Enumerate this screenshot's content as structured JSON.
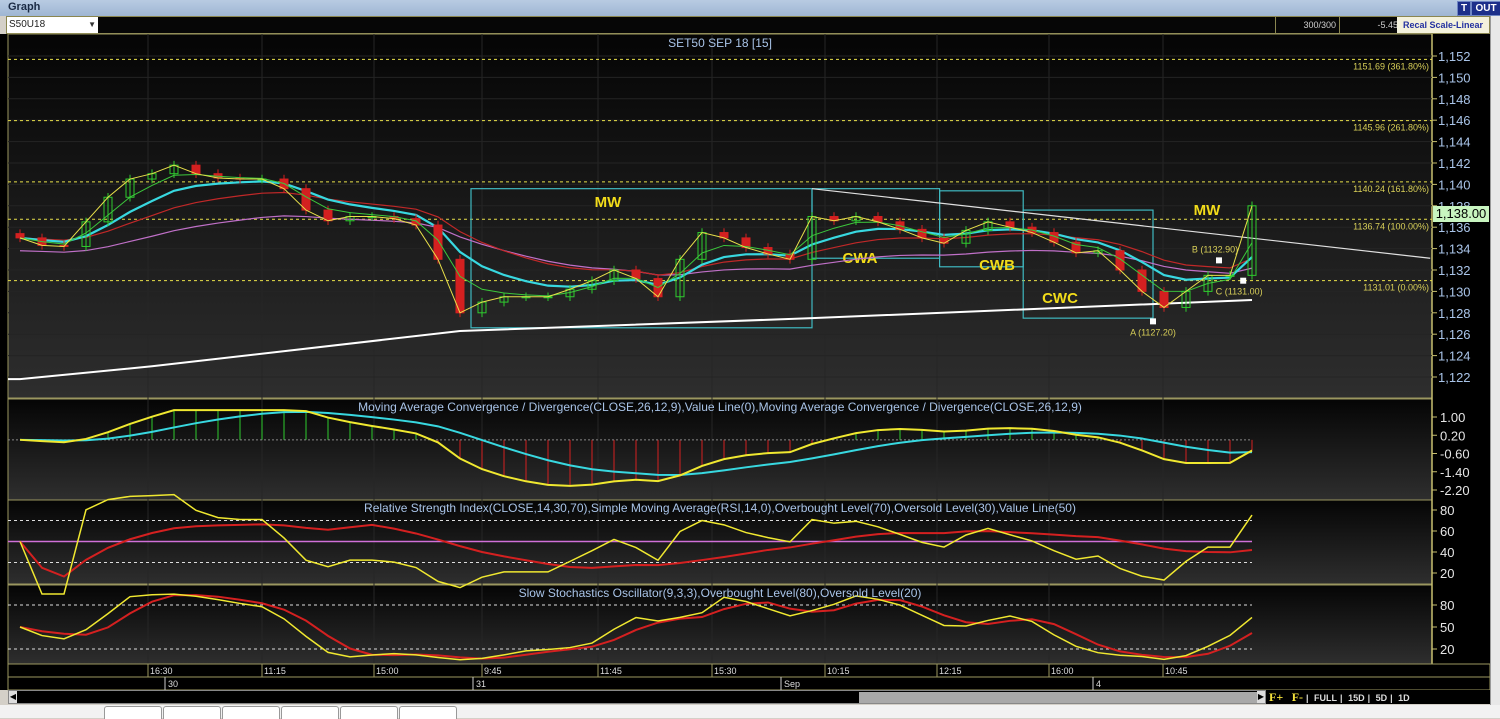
{
  "window": {
    "title": "Graph",
    "t_button": "T",
    "out_button": "OUT"
  },
  "toolbar": {
    "symbol": "S50U18",
    "bars": "300/300",
    "change": "-5.45",
    "recal_button": "Recal Scale-Linear"
  },
  "zoombar": {
    "f_plus": "F+",
    "f_minus": "F-",
    "full": "FULL",
    "d15": "15D",
    "d5": "5D",
    "d1": "1D"
  },
  "colors": {
    "background": "#000000",
    "bull": "#2ecc2e",
    "bear": "#d42020",
    "fib": "#e8e04a",
    "box": "#3fb8c0",
    "axis_text": "#a9c4e8",
    "last_price_bg": "#c8f5c0"
  },
  "chart_data": [
    {
      "type": "candlestick",
      "title": "SET50 SEP 18   [15]",
      "ylim": [
        1121,
        1153
      ],
      "yticks": [
        "1,152",
        "1,150",
        "1,148",
        "1,146",
        "1,144",
        "1,142",
        "1,140",
        "1,138",
        "1,136",
        "1,134",
        "1,132",
        "1,130",
        "1,128",
        "1,126",
        "1,124",
        "1,122"
      ],
      "last_price": "1,138.00",
      "close": [
        1135,
        1134.3,
        1134.2,
        1136.5,
        1138.8,
        1140.5,
        1141,
        1141.8,
        1141,
        1140.6,
        1140.5,
        1140.5,
        1139.6,
        1137.6,
        1136.6,
        1137,
        1137,
        1136.8,
        1136.2,
        1133,
        1128,
        1129,
        1129.5,
        1129.5,
        1129.5,
        1130.2,
        1131,
        1132,
        1131.2,
        1129.5,
        1133,
        1135.5,
        1135,
        1134.1,
        1133.5,
        1133,
        1137,
        1136.6,
        1137,
        1136.5,
        1135.8,
        1135,
        1134.5,
        1135.7,
        1136.5,
        1136,
        1135.5,
        1134.6,
        1133.6,
        1133.8,
        1132,
        1130,
        1128.5,
        1130,
        1131.5,
        1131.5,
        1138
      ],
      "long_ma": [
        {
          "bar": 0,
          "value": 1121.8
        },
        {
          "bar": 6,
          "value": 1123
        },
        {
          "bar": 20,
          "value": 1126.3
        },
        {
          "bar": 36,
          "value": 1127.5
        },
        {
          "bar": 56,
          "value": 1129.2
        }
      ],
      "fib_levels": [
        {
          "value": 1151.69,
          "label": "1151.69 (361.80%)"
        },
        {
          "value": 1145.96,
          "label": "1145.96 (261.80%)"
        },
        {
          "value": 1140.24,
          "label": "1140.24 (161.80%)"
        },
        {
          "value": 1136.74,
          "label": "1136.74 (100.00%)"
        },
        {
          "value": 1131.01,
          "label": "1131.01 (0.00%)"
        }
      ],
      "abc_points": [
        {
          "bar": 51.5,
          "value": 1127.2,
          "label": "A (1127.20)"
        },
        {
          "bar": 54.5,
          "value": 1132.9,
          "label": "B (1132.90)"
        },
        {
          "bar": 55.6,
          "value": 1131.0,
          "label": "C (1131.00)"
        }
      ],
      "pattern_boxes": [
        {
          "label": "MW",
          "from_bar": 20.5,
          "to_bar": 36,
          "high": 1139.6,
          "low": 1126.6
        },
        {
          "label": "CWA",
          "from_bar": 36,
          "to_bar": 41.8,
          "high": 1139.6,
          "low": 1133.1
        },
        {
          "label": "CWB",
          "from_bar": 41.8,
          "to_bar": 45.6,
          "high": 1139.4,
          "low": 1132.3
        },
        {
          "label": "CWC",
          "from_bar": 45.6,
          "to_bar": 51.5,
          "high": 1137.6,
          "low": 1127.5
        },
        {
          "label": "MW",
          "from_bar": null,
          "to_bar": null,
          "high": null,
          "low": null
        }
      ],
      "trendline": [
        {
          "bar": 36,
          "value": 1139.6
        },
        {
          "bar": 64.1,
          "value": 1133.1
        }
      ],
      "xticks": [
        "16:30",
        "11:15",
        "15:00",
        "9:45",
        "11:45",
        "15:30",
        "10:15",
        "12:15",
        "16:00",
        "10:45"
      ],
      "dates": [
        "30",
        "31",
        "Sep",
        "4"
      ]
    },
    {
      "type": "line",
      "title": "Moving Average Convergence / Divergence(CLOSE,26,12,9),Value Line(0),Moving Average Convergence / Divergence(CLOSE,26,12,9)",
      "ylim": [
        -2.6,
        1.4
      ],
      "yticks": [
        "1.00",
        "0.20",
        "-0.60",
        "-1.40",
        "-2.20"
      ],
      "params": {
        "slow": 26,
        "fast": 12,
        "signal": 9
      }
    },
    {
      "type": "line",
      "title": "Relative Strength Index(CLOSE,14,30,70),Simple Moving Average(RSI,14,0),Overbought Level(70),Oversold Level(30),Value Line(50)",
      "ylim": [
        10,
        90
      ],
      "yticks": [
        "80",
        "60",
        "40",
        "20"
      ],
      "params": {
        "period": 14,
        "overbought": 70,
        "oversold": 30,
        "value_line": 50
      }
    },
    {
      "type": "line",
      "title": "Slow Stochastics Oscillator(9,3,3),Overbought Level(80),Oversold Level(20)",
      "ylim": [
        5,
        105
      ],
      "yticks": [
        "80",
        "50",
        "20"
      ],
      "params": {
        "k": 9,
        "slow": 3,
        "d": 3,
        "overbought": 80,
        "oversold": 20
      }
    }
  ]
}
